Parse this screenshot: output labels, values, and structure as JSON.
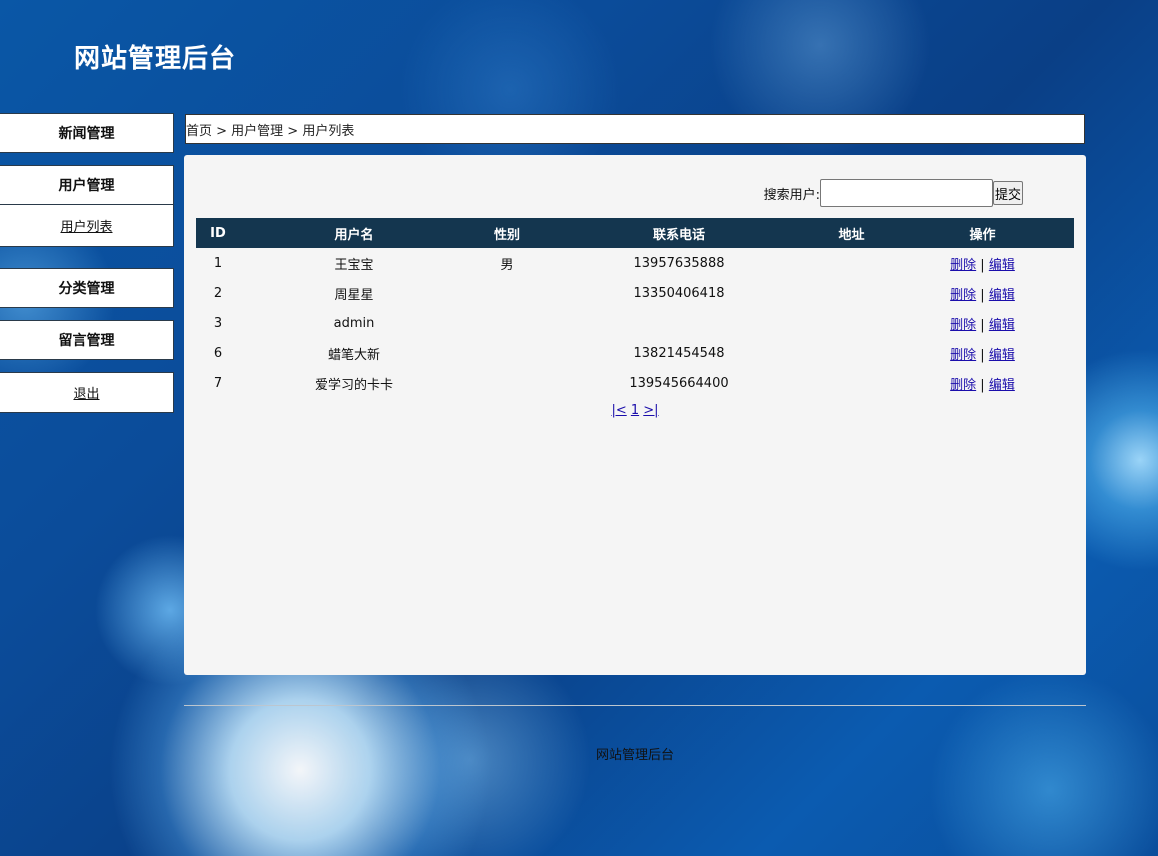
{
  "header": {
    "title": "网站管理后台"
  },
  "sidebar": {
    "news": "新闻管理",
    "users": "用户管理",
    "users_sub": "用户列表",
    "category": "分类管理",
    "messages": "留言管理",
    "logout": "退出"
  },
  "breadcrumb": "首页 > 用户管理 > 用户列表",
  "search": {
    "label": "搜索用户:",
    "value": "",
    "submit": "提交"
  },
  "table": {
    "columns": [
      "ID",
      "用户名",
      "性别",
      "联系电话",
      "地址",
      "操作"
    ],
    "rows": [
      {
        "id": "1",
        "name": "王宝宝",
        "gender": "男",
        "phone": "13957635888",
        "address": ""
      },
      {
        "id": "2",
        "name": "周星星",
        "gender": "",
        "phone": "13350406418",
        "address": ""
      },
      {
        "id": "3",
        "name": "admin",
        "gender": "",
        "phone": "",
        "address": ""
      },
      {
        "id": "6",
        "name": "蜡笔大新",
        "gender": "",
        "phone": "13821454548",
        "address": ""
      },
      {
        "id": "7",
        "name": "爱学习的卡卡",
        "gender": "",
        "phone": "139545664400",
        "address": ""
      }
    ],
    "action_delete": "删除",
    "action_sep": "|",
    "action_edit": "编辑"
  },
  "pager": {
    "first": "|<",
    "current": "1",
    "last": ">|"
  },
  "footer": {
    "text": "网站管理后台"
  }
}
